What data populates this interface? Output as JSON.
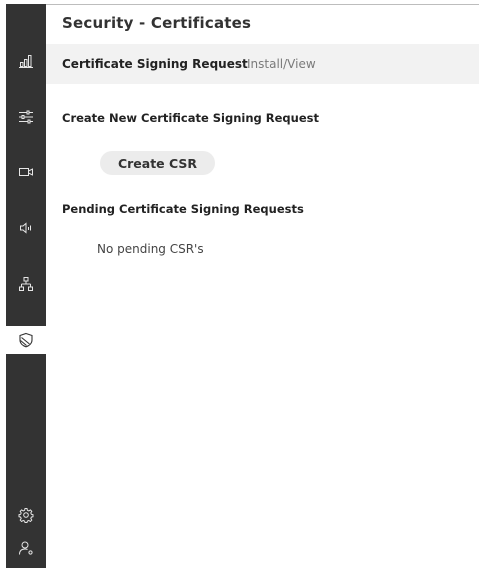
{
  "page": {
    "title": "Security - Certificates"
  },
  "tabs": [
    {
      "label": "Certificate Signing Request",
      "active": true
    },
    {
      "label": "Install/View",
      "active": false
    }
  ],
  "create_section": {
    "heading": "Create New Certificate Signing Request",
    "button_label": "Create CSR"
  },
  "pending_section": {
    "heading": "Pending Certificate Signing Requests",
    "empty_message": "No pending CSR's"
  },
  "sidebar": {
    "items": [
      {
        "icon": "bar-chart-icon",
        "active": false
      },
      {
        "icon": "sliders-icon",
        "active": false
      },
      {
        "icon": "video-camera-icon",
        "active": false
      },
      {
        "icon": "audio-speaker-icon",
        "active": false
      },
      {
        "icon": "network-icon",
        "active": false
      },
      {
        "icon": "shield-icon",
        "active": true
      }
    ],
    "bottom_items": [
      {
        "icon": "gear-icon"
      },
      {
        "icon": "user-settings-icon"
      }
    ]
  },
  "colors": {
    "sidebar_bg": "#333333",
    "sidebar_icon": "#e6e6e6",
    "active_item_bg": "#ffffff",
    "tabbar_bg": "#f2f2f2",
    "button_bg": "#ececec",
    "text_dark": "#333333",
    "text_muted": "#7a7a7a"
  }
}
